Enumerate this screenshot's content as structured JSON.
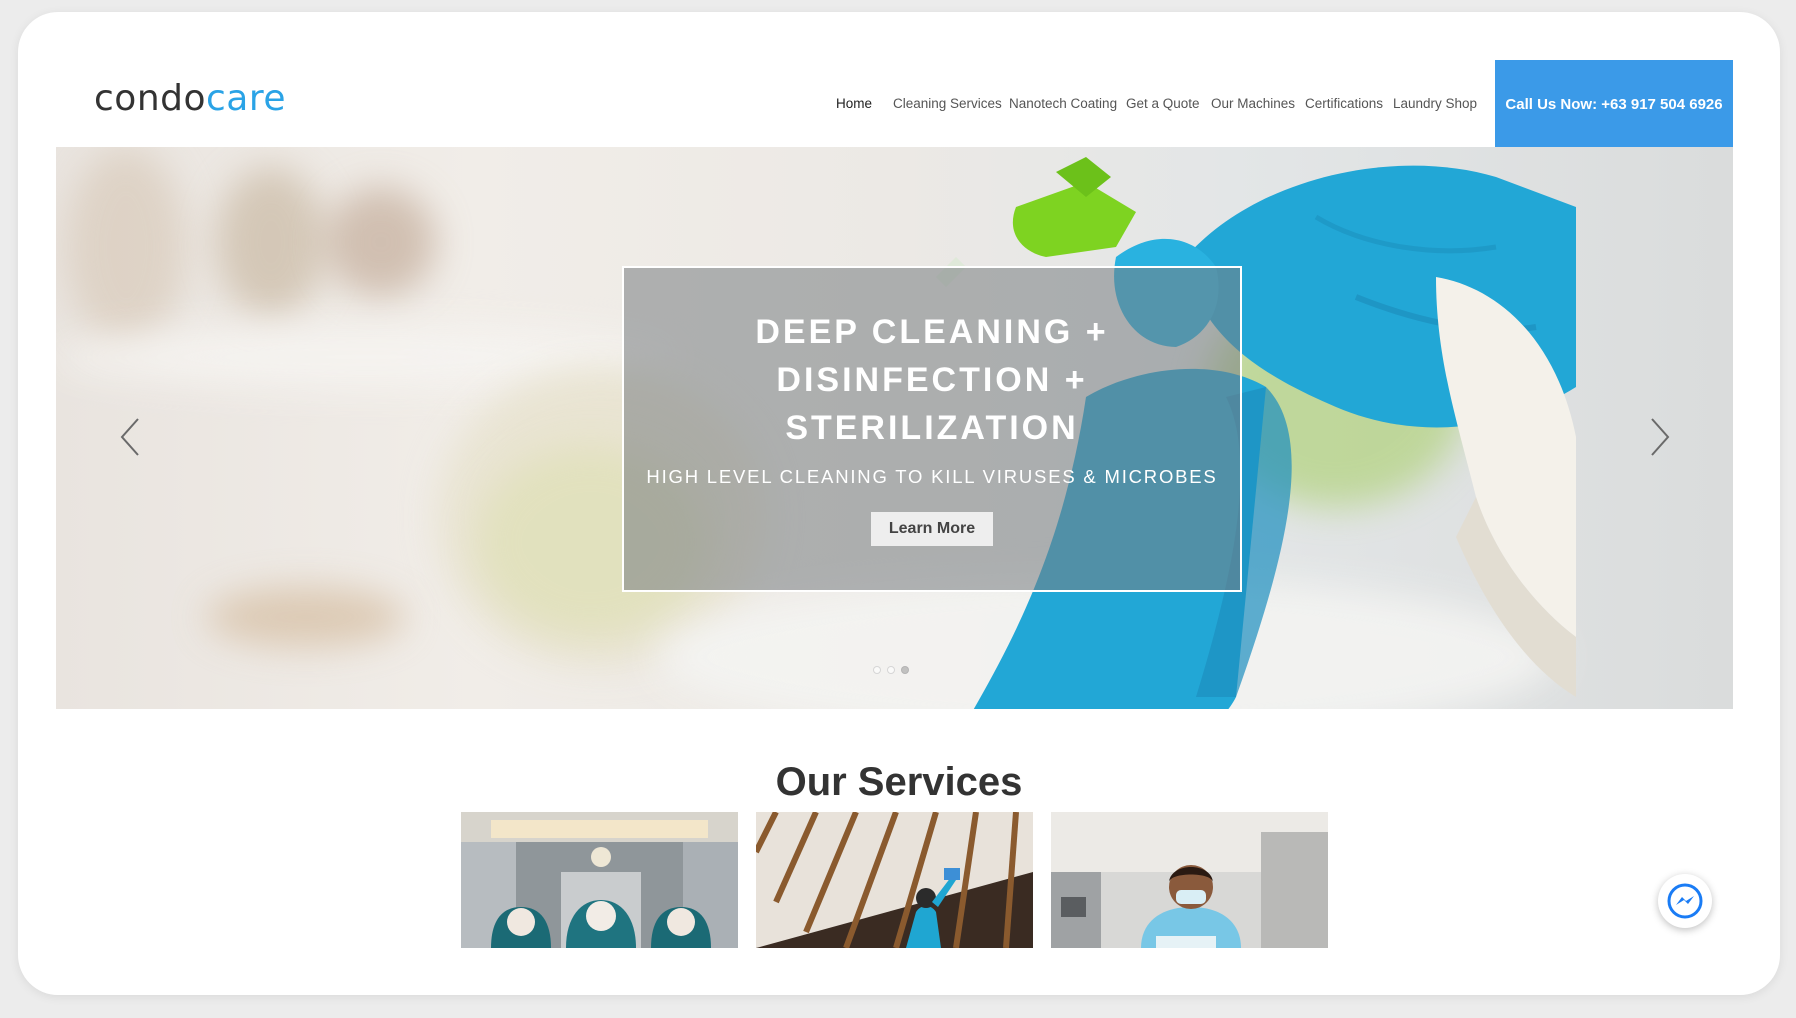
{
  "header": {
    "logo": {
      "part1": "condo",
      "part2": "care"
    },
    "nav": [
      {
        "label": "Home",
        "active": true
      },
      {
        "label": "Cleaning Services"
      },
      {
        "label": "Nanotech Coating"
      },
      {
        "label": "Get a Quote"
      },
      {
        "label": "Our Machines"
      },
      {
        "label": "Certifications"
      },
      {
        "label": "Laundry Shop"
      }
    ],
    "call_button": "Call Us Now: +63 917 504 6926"
  },
  "hero": {
    "title": "DEEP CLEANING + DISINFECTION + STERILIZATION",
    "subtitle": "HIGH LEVEL CLEANING TO KILL VIRUSES & MICROBES",
    "button": "Learn More",
    "slides": 3,
    "active_slide": 3,
    "prev_icon": "chevron-left-icon",
    "next_icon": "chevron-right-icon"
  },
  "services": {
    "title": "Our Services"
  },
  "colors": {
    "accent": "#3b9ae8",
    "logo_blue": "#2aa3e6",
    "glove": "#1fa6d2",
    "messenger": "#1a7cf5"
  },
  "messenger_icon": "messenger-icon"
}
